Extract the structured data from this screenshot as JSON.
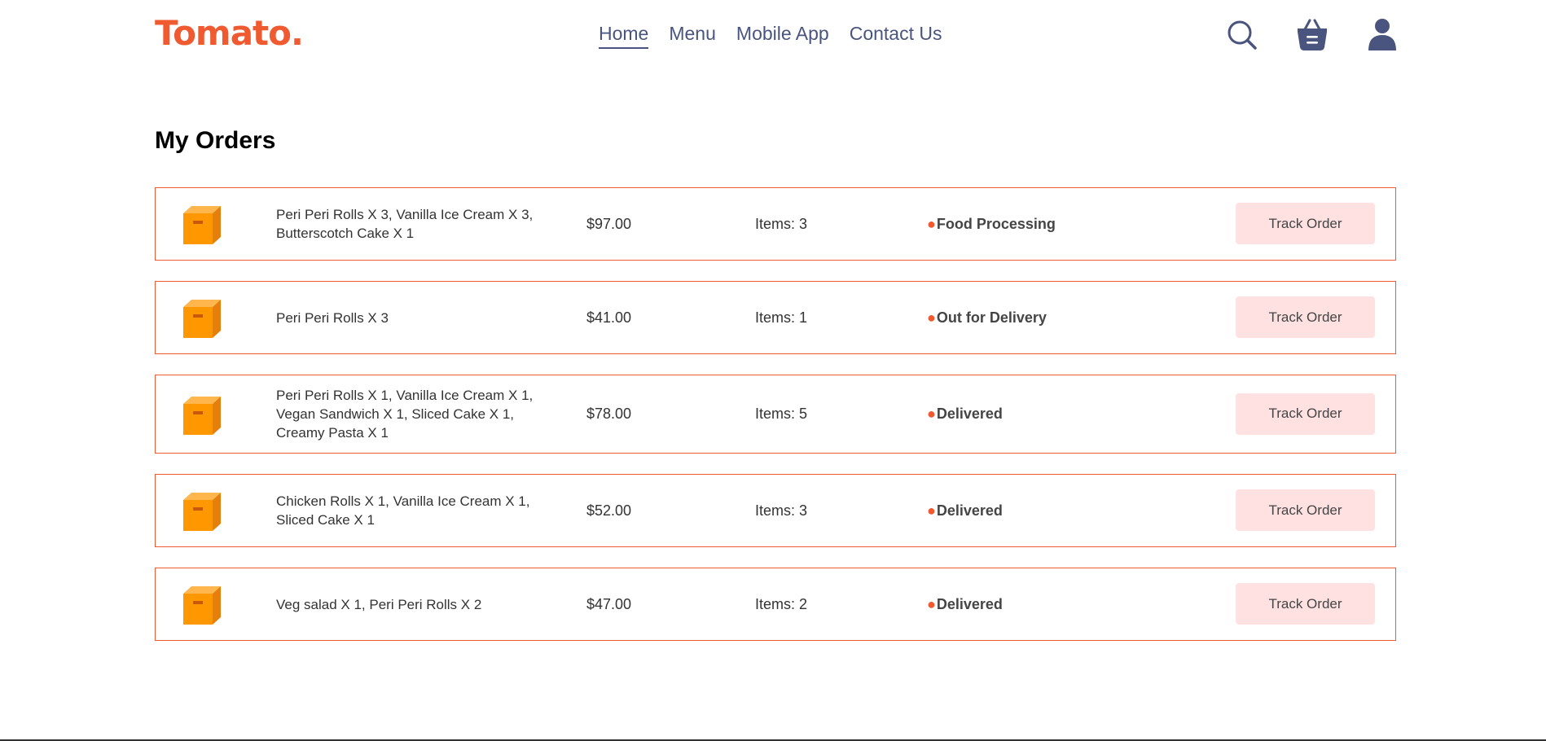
{
  "navbar": {
    "logo": "Tomato.",
    "links": [
      {
        "label": "Home",
        "active": true
      },
      {
        "label": "Menu",
        "active": false
      },
      {
        "label": "Mobile App",
        "active": false
      },
      {
        "label": "Contact Us",
        "active": false
      }
    ],
    "icons": [
      "search-icon",
      "basket-icon",
      "profile-icon"
    ]
  },
  "page": {
    "title": "My Orders"
  },
  "orders": [
    {
      "items": "Peri Peri Rolls X 3, Vanilla Ice Cream X 3, Butterscotch Cake X 1",
      "amount": "$97.00",
      "count": "Items: 3",
      "status": "Food Processing",
      "button": "Track Order"
    },
    {
      "items": "Peri Peri Rolls X 3",
      "amount": "$41.00",
      "count": "Items: 1",
      "status": "Out for Delivery",
      "button": "Track Order"
    },
    {
      "items": "Peri Peri Rolls X 1, Vanilla Ice Cream X 1, Vegan Sandwich X 1, Sliced Cake X 1, Creamy Pasta X 1",
      "amount": "$78.00",
      "count": "Items: 5",
      "status": "Delivered",
      "button": "Track Order"
    },
    {
      "items": "Chicken Rolls X 1, Vanilla Ice Cream X 1, Sliced Cake X 1",
      "amount": "$52.00",
      "count": "Items: 3",
      "status": "Delivered",
      "button": "Track Order"
    },
    {
      "items": "Veg salad X 1, Peri Peri Rolls X 2",
      "amount": "$47.00",
      "count": "Items: 2",
      "status": "Delivered",
      "button": "Track Order"
    }
  ],
  "colors": {
    "accent": "#ef5a31",
    "nav_text": "#49557e",
    "button_bg": "#ffe1e1",
    "parcel": "#ff9800"
  }
}
